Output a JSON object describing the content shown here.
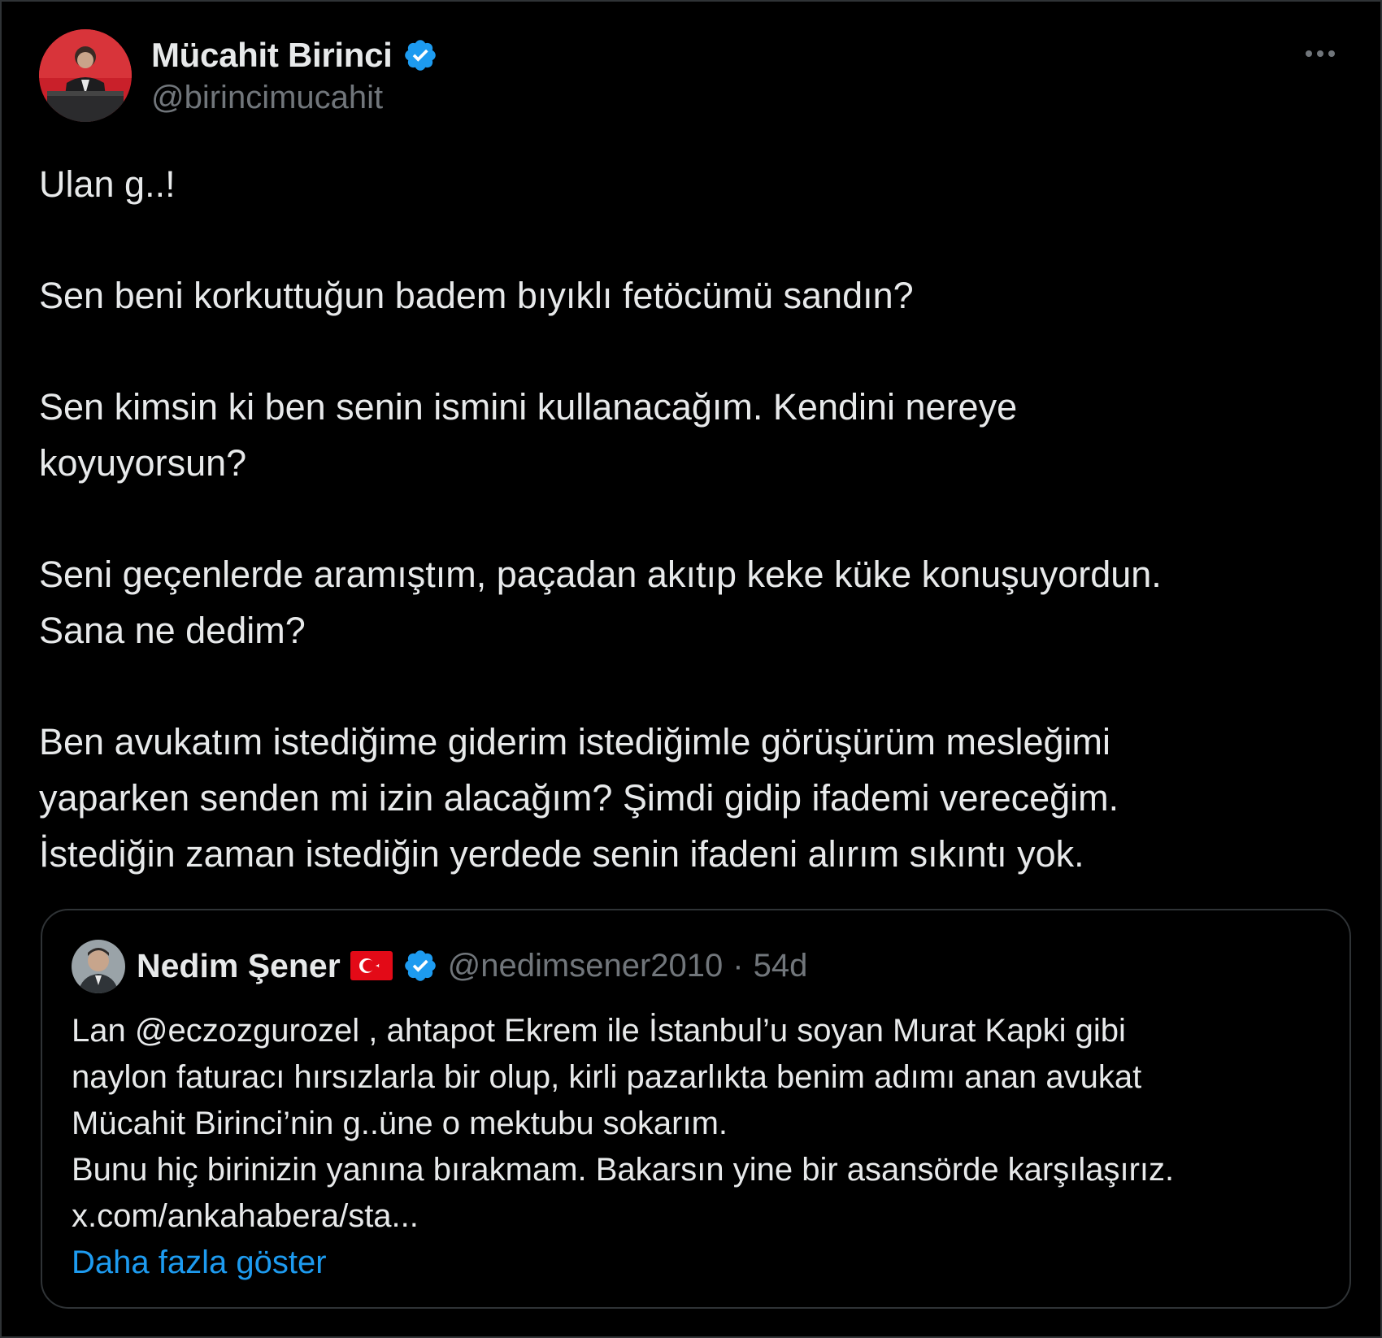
{
  "tweet": {
    "author": {
      "name": "Mücahit Birinci",
      "handle": "@birincimucahit",
      "verified": true
    },
    "paragraphs": [
      "Ulan g..!",
      "Sen beni korkuttuğun badem bıyıklı fetöcümü sandın?",
      "Sen kimsin ki ben senin ismini kullanacağım. Kendini nereye\nkoyuyorsun?",
      "Seni geçenlerde aramıştım, paçadan akıtıp keke küke konuşuyordun.\nSana ne dedim?",
      "Ben avukatım istediğime giderim istediğimle görüşürüm mesleğimi\nyaparken senden mi izin alacağım? Şimdi gidip ifademi vereceğim.\nİstediğin zaman istediğin yerdede senin ifadeni alırım sıkıntı yok."
    ]
  },
  "quoted": {
    "author": {
      "name": "Nedim Şener",
      "handle": "@nedimsener2010",
      "separator": "·",
      "time": "54d",
      "verified": true,
      "flag": "turkey-flag"
    },
    "lines": [
      "Lan @eczozgurozel , ahtapot Ekrem ile İstanbul’u soyan Murat Kapki gibi",
      "naylon faturacı hırsızlarla bir olup, kirli pazarlıkta benim adımı anan avukat",
      "Mücahit Birinci’nin g..üne o mektubu sokarım.",
      "Bunu hiç birinizin yanına bırakmam. Bakarsın yine bir asansörde karşılaşırız.",
      "x.com/ankahabera/sta..."
    ],
    "show_more": "Daha fazla göster"
  },
  "colors": {
    "background": "#000000",
    "text": "#e7e9ea",
    "secondary": "#71767b",
    "link": "#1d9bf0",
    "verified": "#1d9bf0",
    "border": "#2f3336"
  }
}
